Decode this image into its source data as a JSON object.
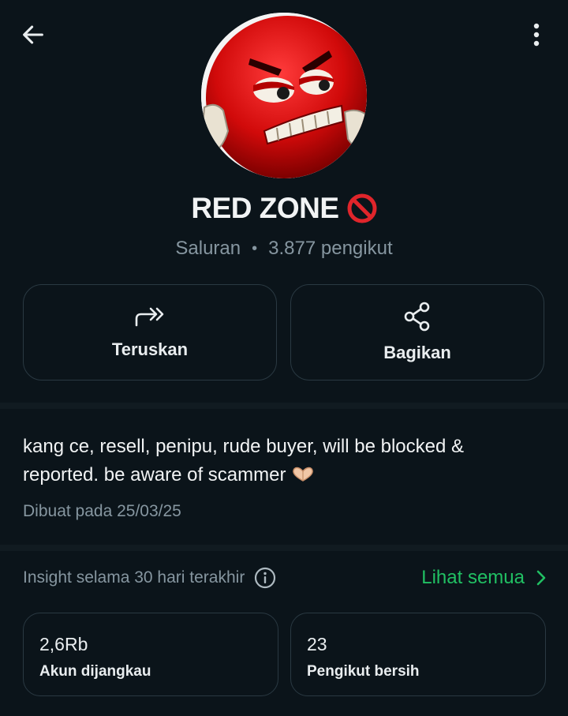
{
  "header": {
    "back_icon": "arrow-left-icon",
    "menu_icon": "more-vertical-icon"
  },
  "channel": {
    "name": "RED ZONE",
    "name_emoji": "no-entry-icon",
    "type": "Saluran",
    "separator": "•",
    "followers": "3.877 pengikut",
    "avatar_icon": "angry-red-candy-avatar"
  },
  "actions": [
    {
      "label": "Teruskan",
      "icon": "forward-icon"
    },
    {
      "label": "Bagikan",
      "icon": "share-icon"
    }
  ],
  "description": {
    "text": "kang ce, resell, penipu, rude buyer, will be blocked & reported. be aware of scammer",
    "emoji": "heart-hands-icon",
    "created": "Dibuat pada 25/03/25"
  },
  "insights": {
    "title": "Insight selama 30 hari terakhir",
    "info_icon": "info-icon",
    "see_all": "Lihat semua",
    "accent_color": "#21c063",
    "stats": [
      {
        "value": "2,6Rb",
        "label": "Akun dijangkau"
      },
      {
        "value": "23",
        "label": "Pengikut bersih"
      }
    ]
  }
}
